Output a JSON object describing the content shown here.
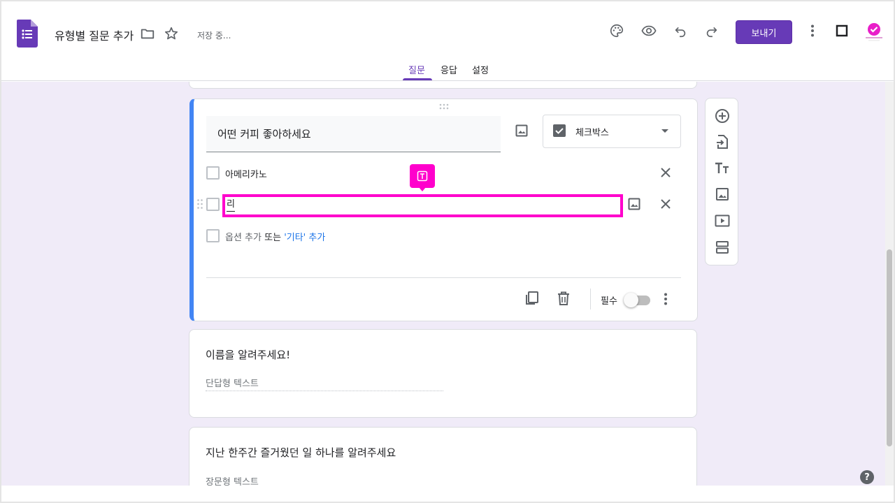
{
  "header": {
    "title": "유형별 질문 추가",
    "saving_status": "저장 중...",
    "send_label": "보내기",
    "accent_color": "#673ab7"
  },
  "tabs": [
    {
      "label": "질문",
      "active": true
    },
    {
      "label": "응답",
      "active": false
    },
    {
      "label": "설정",
      "active": false
    }
  ],
  "active_question": {
    "title": "어떤 커피 좋아하세요",
    "type_label": "체크박스",
    "options": [
      "아메리카노"
    ],
    "editing_value": "리",
    "add_option": "옵션 추가",
    "or": "또는",
    "add_other": "'기타' 추가",
    "required_label": "필수",
    "required": false
  },
  "side_toolbar": [
    "add-question-icon",
    "import-questions-icon",
    "add-title-icon",
    "add-image-icon",
    "add-video-icon",
    "add-section-icon"
  ],
  "questions": [
    {
      "title": "이름을 알려주세요!",
      "placeholder": "단답형 텍스트"
    },
    {
      "title": "지난 한주간 즐거웠던 일 하나를 알려주세요",
      "placeholder": "장문형 텍스트"
    }
  ],
  "help": "?"
}
